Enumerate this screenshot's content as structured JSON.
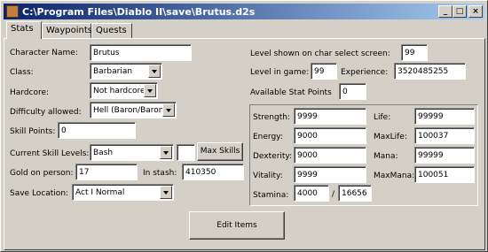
{
  "window": {
    "title": "C:\\Program Files\\Diablo II\\save\\Brutus.d2s",
    "minimize_glyph": "_",
    "maximize_glyph": "□",
    "close_glyph": "×"
  },
  "tabs": [
    {
      "label": "Stats",
      "active": true
    },
    {
      "label": "Waypoints",
      "active": false
    },
    {
      "label": "Quests",
      "active": false
    }
  ],
  "character": {
    "name_label": "Character Name:",
    "name_value": "Brutus",
    "class_label": "Class:",
    "class_value": "Barbarian",
    "hardcore_label": "Hardcore:",
    "hardcore_value": "Not hardcore",
    "difficulty_label": "Difficulty allowed:",
    "difficulty_value": "Hell (Baron/Baron",
    "skill_points_label": "Skill Points:",
    "skill_points_value": "0",
    "skill_levels_label": "Current Skill Levels:",
    "skill_levels_value": "Bash",
    "skill_level_number": "",
    "max_skills_label": "Max Skills",
    "gold_label": "Gold on person:",
    "gold_value": "17",
    "stash_label": "In stash:",
    "stash_value": "410350",
    "save_location_label": "Save Location:",
    "save_location_value": "Act I Normal"
  },
  "level": {
    "select_screen_label": "Level shown on char select screen:",
    "select_screen_value": "99",
    "in_game_label": "Level in game:",
    "in_game_value": "99",
    "experience_label": "Experience:",
    "experience_value": "3520485255",
    "stat_points_label": "Available Stat Points",
    "stat_points_value": "0"
  },
  "stats": {
    "strength_label": "Strength:",
    "strength_value": "9999",
    "energy_label": "Energy:",
    "energy_value": "9000",
    "dexterity_label": "Dexterity:",
    "dexterity_value": "9000",
    "vitality_label": "Vitality:",
    "vitality_value": "9999",
    "stamina_label": "Stamina:",
    "stamina_value": "4000",
    "stamina_sep": "/",
    "stamina_max": "16656",
    "life_label": "Life:",
    "life_value": "99999",
    "maxlife_label": "MaxLife:",
    "maxlife_value": "100037",
    "mana_label": "Mana:",
    "mana_value": "99999",
    "maxmana_label": "MaxMana:",
    "maxmana_value": "100051"
  },
  "edit_items_label": "Edit Items"
}
